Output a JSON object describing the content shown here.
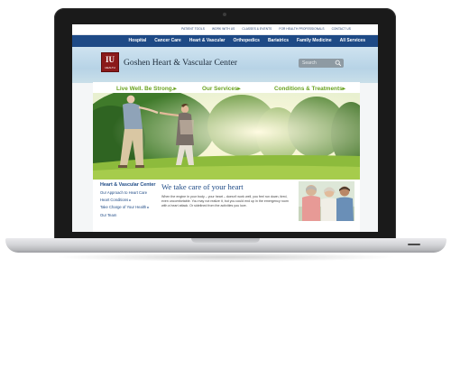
{
  "site": {
    "top_links": [
      "PATIENT TOOLS",
      "WORK WITH US",
      "CLASSES & EVENTS",
      "FOR HEALTH PROFESSIONALS",
      "CONTACT US"
    ],
    "nav_items": [
      "Hospital",
      "Cancer Care",
      "Heart & Vascular",
      "Orthopedics",
      "Bariatrics",
      "Family Medicine",
      "All Services"
    ],
    "logo_mark": "IU",
    "logo_sub": "HEALTH",
    "title": "Goshen Heart & Vascular Center",
    "search": {
      "placeholder": "Search"
    },
    "promos": [
      "Live Well. Be Strong.▸",
      "Our Services▸",
      "Conditions & Treatments▸"
    ],
    "sidebar": {
      "title": "Heart & Vascular Center",
      "items": [
        "Our Approach to Heart Care",
        "Heart Conditions ▸",
        "Take Charge of Your Health ▸",
        "Our Team"
      ]
    },
    "main": {
      "heading": "We take care of your heart",
      "body": "When the engine in your body – your heart – doesn't work well, you feel run down, tired, even uncomfortable. You may not realize it, but you could end up in the emergency room with a heart attack. Or sidelined from the activities you love."
    }
  },
  "colors": {
    "nav_blue": "#1e4a86",
    "promo_green": "#6aa320",
    "logo_red": "#8b1a1a"
  }
}
